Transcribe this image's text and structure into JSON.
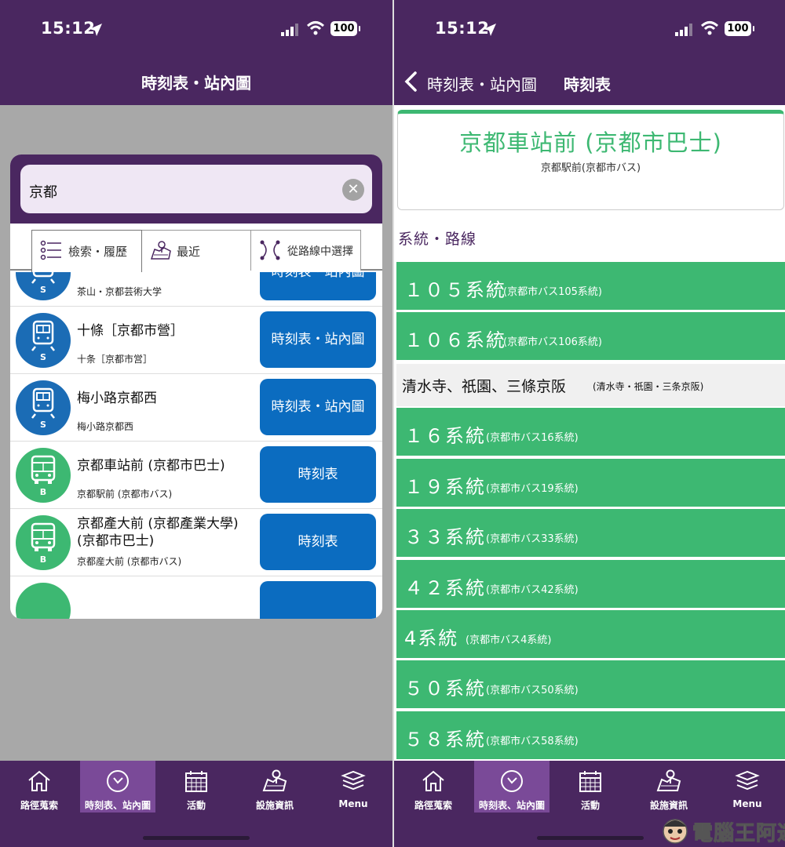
{
  "left": {
    "status": {
      "time": "15:12",
      "battery": "100"
    },
    "nav_title": "時刻表・站內圖",
    "search": {
      "value": "京都"
    },
    "tabs": [
      {
        "label": "檢索・履歷",
        "icon": "list-icon"
      },
      {
        "label": "最近",
        "icon": "map-icon"
      },
      {
        "label": "從路線中選擇",
        "icon": "route-network-icon"
      }
    ],
    "results": [
      {
        "name": "",
        "sub": "茶山・京都芸術大学",
        "badge_type": "s",
        "badge_code": "S",
        "button": "時刻表・站內圖"
      },
      {
        "name": "十條［京都市營］",
        "sub": "十条［京都市営］",
        "badge_type": "s",
        "badge_code": "S",
        "button": "時刻表・站內圖"
      },
      {
        "name": "梅小路京都西",
        "sub": "梅小路京都西",
        "badge_type": "s",
        "badge_code": "S",
        "button": "時刻表・站內圖"
      },
      {
        "name": "京都車站前 (京都市巴士)",
        "sub": "京都駅前 (京都市バス)",
        "badge_type": "b",
        "badge_code": "B",
        "button": "時刻表"
      },
      {
        "name": "京都產大前 (京都產業大學) (京都市巴士)",
        "sub": "京都産大前 (京都市バス)",
        "badge_type": "b",
        "badge_code": "B",
        "button": "時刻表"
      }
    ]
  },
  "right": {
    "status": {
      "time": "15:12",
      "battery": "100"
    },
    "back_label": "時刻表・站內圖",
    "nav_title": "時刻表",
    "station": {
      "name": "京都車站前 (京都市巴士)",
      "sub": "京都駅前(京都市バス)"
    },
    "section_title": "系統・路線",
    "routes": [
      {
        "kind": "route",
        "name": "１０５系統",
        "sub": "(京都市バス105系統)"
      },
      {
        "kind": "route",
        "name": "１０６系統",
        "sub": "(京都市バス106系統)"
      },
      {
        "kind": "group",
        "name": "清水寺、祇園、三條京阪",
        "sub": "(清水寺・祇園・三条京阪)"
      },
      {
        "kind": "route",
        "name": "１６系統",
        "sub": "(京都市バス16系統)"
      },
      {
        "kind": "route",
        "name": "１９系統",
        "sub": "(京都市バス19系統)"
      },
      {
        "kind": "route",
        "name": "３３系統",
        "sub": "(京都市バス33系統)"
      },
      {
        "kind": "route",
        "name": "４２系統",
        "sub": "(京都市バス42系統)"
      },
      {
        "kind": "route",
        "name": "4系統",
        "sub": "(京都市バス4系統)"
      },
      {
        "kind": "route",
        "name": "５０系統",
        "sub": "(京都市バス50系統)"
      },
      {
        "kind": "route",
        "name": "５８系統",
        "sub": "(京都市バス58系統)"
      }
    ]
  },
  "bottom_nav": [
    {
      "label": "路徑蒐索",
      "icon": "home-icon",
      "active": false
    },
    {
      "label": "時刻表、站內圖",
      "icon": "clock-icon",
      "active": true
    },
    {
      "label": "活動",
      "icon": "calendar-icon",
      "active": false
    },
    {
      "label": "設施資訊",
      "icon": "map-icon",
      "active": false
    },
    {
      "label": "Menu",
      "icon": "layers-icon",
      "active": false
    }
  ],
  "watermark": {
    "text": "電腦王阿達"
  },
  "colors": {
    "brand": "#4a2760",
    "active_tab": "#7a4a98",
    "bus_green": "#3db872",
    "subway_blue": "#1b6cb5",
    "button_blue": "#0b6cc0"
  }
}
